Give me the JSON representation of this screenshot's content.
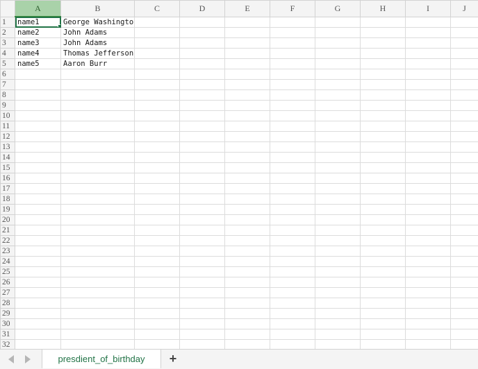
{
  "spreadsheet": {
    "columns": [
      "A",
      "B",
      "C",
      "D",
      "E",
      "F",
      "G",
      "H",
      "I",
      "J"
    ],
    "row_numbers": [
      "1",
      "2",
      "3",
      "4",
      "5",
      "6",
      "7",
      "8",
      "9",
      "10",
      "11",
      "12",
      "13",
      "14",
      "15",
      "16",
      "17",
      "18",
      "19",
      "20",
      "21",
      "22",
      "23",
      "24",
      "25",
      "26",
      "27",
      "28",
      "29",
      "30",
      "31",
      "32"
    ],
    "rows": [
      [
        "name1",
        "George Washington"
      ],
      [
        "name2",
        "John Adams"
      ],
      [
        "name3",
        "John Adams"
      ],
      [
        "name4",
        "Thomas Jefferson"
      ],
      [
        "name5",
        "Aaron Burr"
      ]
    ],
    "active_cell": "A1",
    "selection_color": "#217346",
    "header_highlight_color": "#a9d2a9"
  },
  "sheet_tabs": {
    "tabs": [
      {
        "label": "presdient_of_birthday",
        "active": true
      }
    ],
    "add_icon": "plus-icon",
    "add_label": "+",
    "prev_icon": "triangle-left-icon",
    "next_icon": "triangle-right-icon"
  }
}
